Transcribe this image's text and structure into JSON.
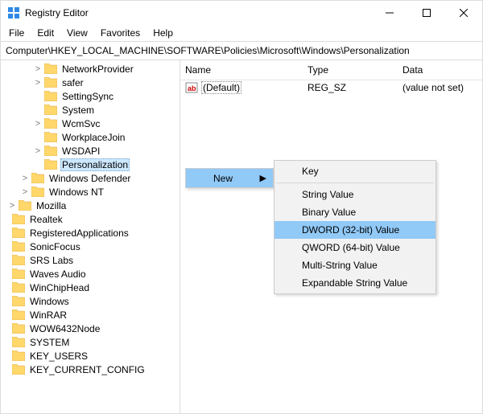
{
  "titlebar": {
    "title": "Registry Editor"
  },
  "menu": {
    "file": "File",
    "edit": "Edit",
    "view": "View",
    "favorites": "Favorites",
    "help": "Help"
  },
  "address": {
    "path": "Computer\\HKEY_LOCAL_MACHINE\\SOFTWARE\\Policies\\Microsoft\\Windows\\Personalization"
  },
  "list": {
    "headers": {
      "name": "Name",
      "type": "Type",
      "data": "Data"
    },
    "rows": [
      {
        "name": "(Default)",
        "type": "REG_SZ",
        "data": "(value not set)"
      }
    ]
  },
  "tree": {
    "g1": [
      {
        "label": "NetworkProvider",
        "tw": ">"
      },
      {
        "label": "safer",
        "tw": ">"
      },
      {
        "label": "SettingSync",
        "tw": ""
      },
      {
        "label": "System",
        "tw": ""
      },
      {
        "label": "WcmSvc",
        "tw": ">"
      },
      {
        "label": "WorkplaceJoin",
        "tw": ""
      },
      {
        "label": "WSDAPI",
        "tw": ">"
      },
      {
        "label": "Personalization",
        "tw": "",
        "selected": true
      }
    ],
    "l2a": {
      "label": "Windows Defender",
      "tw": ">"
    },
    "l2b": {
      "label": "Windows NT",
      "tw": ">"
    },
    "l1a": {
      "label": "Mozilla",
      "tw": ">"
    },
    "r": [
      {
        "label": "Realtek"
      },
      {
        "label": "RegisteredApplications"
      },
      {
        "label": "SonicFocus"
      },
      {
        "label": "SRS Labs"
      },
      {
        "label": "Waves Audio"
      },
      {
        "label": "WinChipHead"
      },
      {
        "label": "Windows"
      },
      {
        "label": "WinRAR"
      },
      {
        "label": "WOW6432Node"
      }
    ],
    "roots": [
      {
        "label": "SYSTEM"
      },
      {
        "label": "KEY_USERS"
      },
      {
        "label": "KEY_CURRENT_CONFIG"
      }
    ]
  },
  "ctx": {
    "parent": "New",
    "items": [
      "Key",
      "String Value",
      "Binary Value",
      "DWORD (32-bit) Value",
      "QWORD (64-bit) Value",
      "Multi-String Value",
      "Expandable String Value"
    ],
    "highlight": "DWORD (32-bit) Value"
  }
}
